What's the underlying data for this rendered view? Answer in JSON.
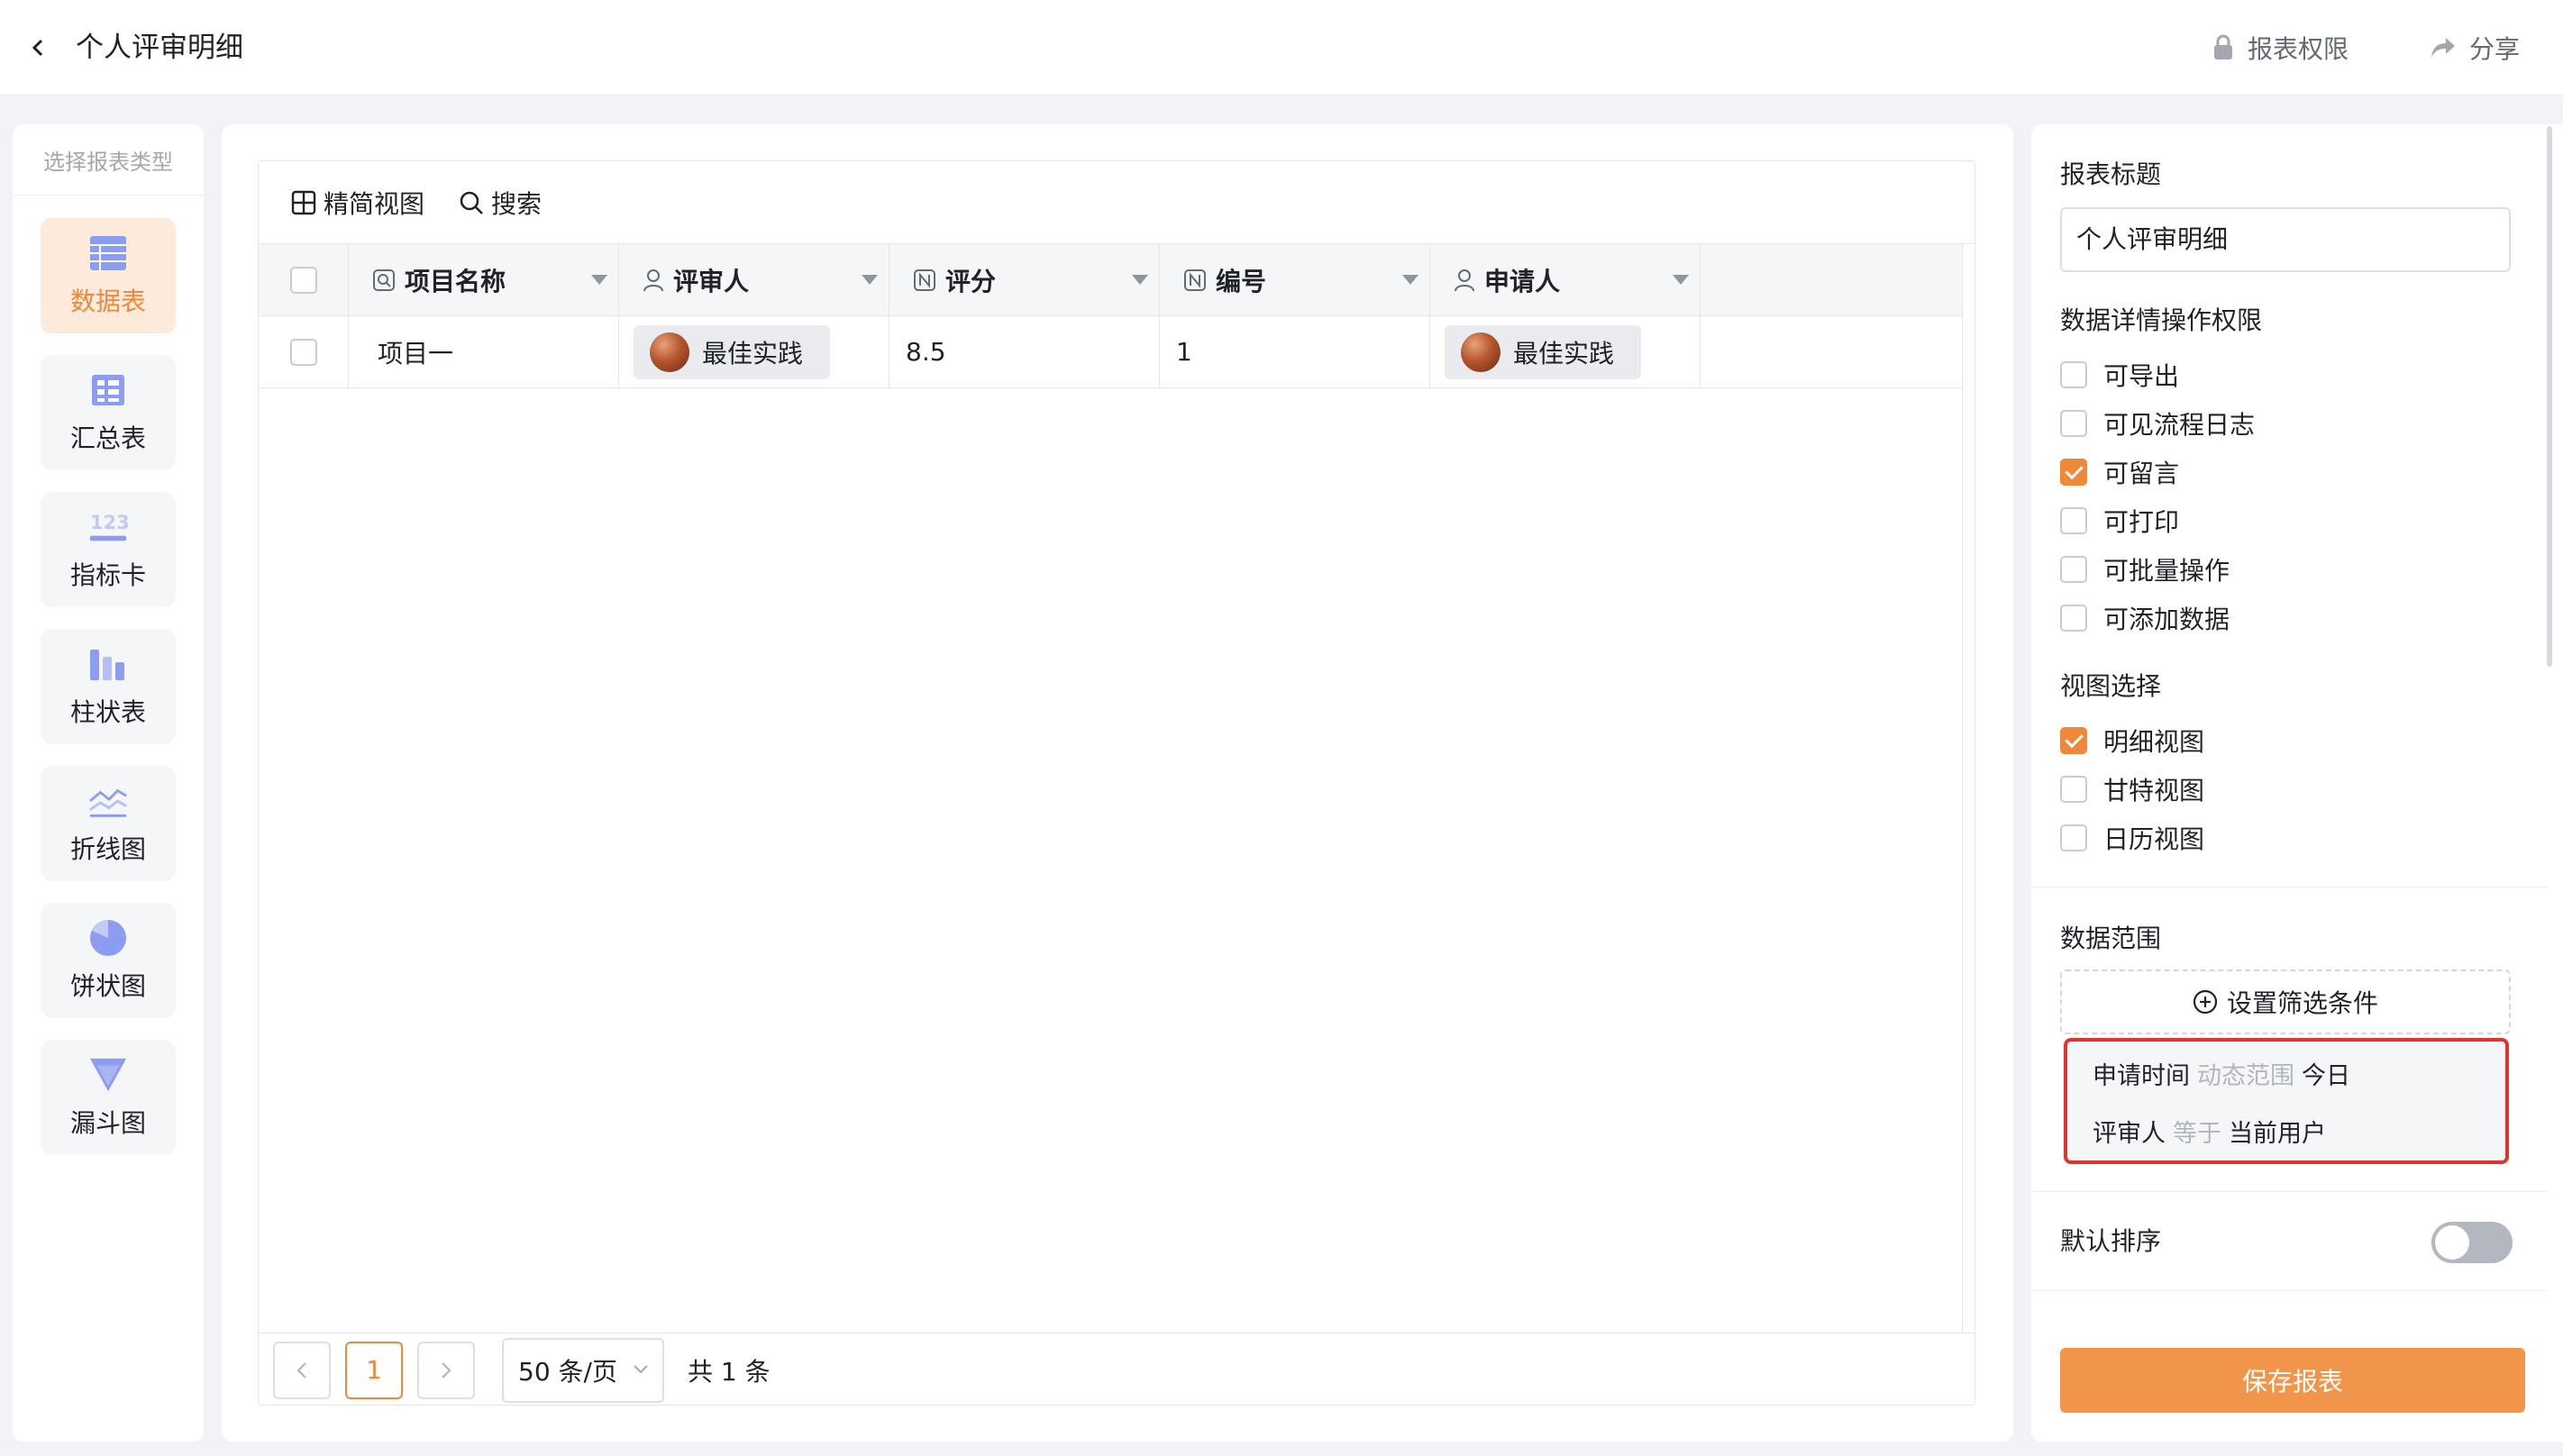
{
  "header": {
    "title": "个人评审明细",
    "permission_label": "报表权限",
    "share_label": "分享"
  },
  "sidebar": {
    "title": "选择报表类型",
    "items": [
      {
        "label": "数据表",
        "icon": "table-icon",
        "active": true
      },
      {
        "label": "汇总表",
        "icon": "pivot-table-icon",
        "active": false
      },
      {
        "label": "指标卡",
        "icon": "metric-card-icon",
        "active": false
      },
      {
        "label": "柱状表",
        "icon": "bar-chart-icon",
        "active": false
      },
      {
        "label": "折线图",
        "icon": "line-chart-icon",
        "active": false
      },
      {
        "label": "饼状图",
        "icon": "pie-chart-icon",
        "active": false
      },
      {
        "label": "漏斗图",
        "icon": "funnel-chart-icon",
        "active": false
      }
    ]
  },
  "toolbar": {
    "compact_view_label": "精简视图",
    "search_label": "搜索"
  },
  "table": {
    "columns": [
      {
        "label": "项目名称",
        "icon": "search-field-icon"
      },
      {
        "label": "评审人",
        "icon": "user-icon"
      },
      {
        "label": "评分",
        "icon": "number-icon"
      },
      {
        "label": "编号",
        "icon": "number-icon"
      },
      {
        "label": "申请人",
        "icon": "user-icon"
      }
    ],
    "rows": [
      {
        "project": "项目一",
        "reviewer": "最佳实践",
        "score": "8.5",
        "number": "1",
        "applicant": "最佳实践"
      }
    ]
  },
  "pagination": {
    "current_page": "1",
    "page_size": "50 条/页",
    "total": "共 1 条"
  },
  "config": {
    "report_title_label": "报表标题",
    "report_title_value": "个人评审明细",
    "permissions_label": "数据详情操作权限",
    "permissions": [
      {
        "label": "可导出",
        "checked": false
      },
      {
        "label": "可见流程日志",
        "checked": false
      },
      {
        "label": "可留言",
        "checked": true
      },
      {
        "label": "可打印",
        "checked": false
      },
      {
        "label": "可批量操作",
        "checked": false
      },
      {
        "label": "可添加数据",
        "checked": false
      }
    ],
    "view_label": "视图选择",
    "views": [
      {
        "label": "明细视图",
        "checked": true
      },
      {
        "label": "甘特视图",
        "checked": false
      },
      {
        "label": "日历视图",
        "checked": false
      }
    ],
    "data_range_label": "数据范围",
    "add_filter_label": "设置筛选条件",
    "filters": [
      {
        "field": "申请时间",
        "op": "动态范围",
        "value": "今日"
      },
      {
        "field": "评审人",
        "op": "等于",
        "value": "当前用户"
      }
    ],
    "default_sort_label": "默认排序",
    "default_sort_on": false,
    "save_label": "保存报表"
  },
  "colors": {
    "accent": "#f0883a",
    "highlight_border": "#e0342f"
  }
}
